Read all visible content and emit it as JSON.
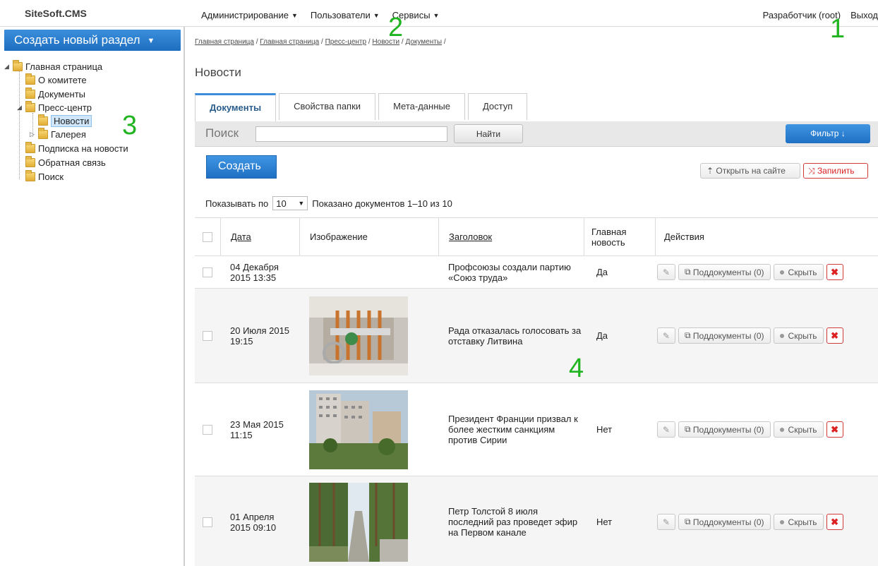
{
  "header": {
    "logo": "SiteSoft.CMS",
    "menu": [
      {
        "label": "Администрирование"
      },
      {
        "label": "Пользователи"
      },
      {
        "label": "Сервисы"
      }
    ],
    "user": "Разработчик (root)",
    "logout": "Выход"
  },
  "markers": [
    "1",
    "2",
    "3",
    "4"
  ],
  "sidebar": {
    "create_label": "Создать новый раздел",
    "tree": [
      {
        "label": "Главная страница"
      },
      {
        "label": "О комитете"
      },
      {
        "label": "Документы"
      },
      {
        "label": "Пресс-центр"
      },
      {
        "label": "Новости"
      },
      {
        "label": "Галерея"
      },
      {
        "label": "Подписка на новости"
      },
      {
        "label": "Обратная связь"
      },
      {
        "label": "Поиск"
      }
    ]
  },
  "breadcrumb": [
    "Главная страница",
    "Главная страница",
    "Пресс-центр",
    "Новости",
    "Документы"
  ],
  "page_title": "Новости",
  "tabs": [
    "Документы",
    "Свойства папки",
    "Мета-данные",
    "Доступ"
  ],
  "search": {
    "label": "Поиск",
    "value": "",
    "button": "Найти",
    "filter": "Фильтр ↓"
  },
  "toolbar": {
    "create": "Создать",
    "open_site": "Открыть на сайте",
    "pin": "Запилить"
  },
  "paging": {
    "prefix": "Показывать по",
    "page_size": "10",
    "summary": "Показано документов 1–10 из 10"
  },
  "table": {
    "columns": {
      "date": "Дата",
      "image": "Изображение",
      "title": "Заголовок",
      "main_news": "Главная новость",
      "actions": "Действия"
    },
    "subdocs_label": "Поддокументы (0)",
    "hide_label": "Скрыть",
    "rows": [
      {
        "date": "04 Декабря 2015 13:35",
        "title": "Профсоюзы создали партию «Союз труда»",
        "main": "Да",
        "image": "none"
      },
      {
        "date": "20 Июля 2015 19:15",
        "title": "Рада отказалась голосовать за отставку Литвина",
        "main": "Да",
        "image": "pipes-photo"
      },
      {
        "date": "23 Мая 2015 11:15",
        "title": "Президент Франции призвал к более жестким санкциям против Сирии",
        "main": "Нет",
        "image": "buildings-photo"
      },
      {
        "date": "01 Апреля 2015 09:10",
        "title": "Петр Толстой 8 июля последний раз проведет эфир на Первом канале",
        "main": "Нет",
        "image": "forest-road-photo"
      }
    ]
  }
}
